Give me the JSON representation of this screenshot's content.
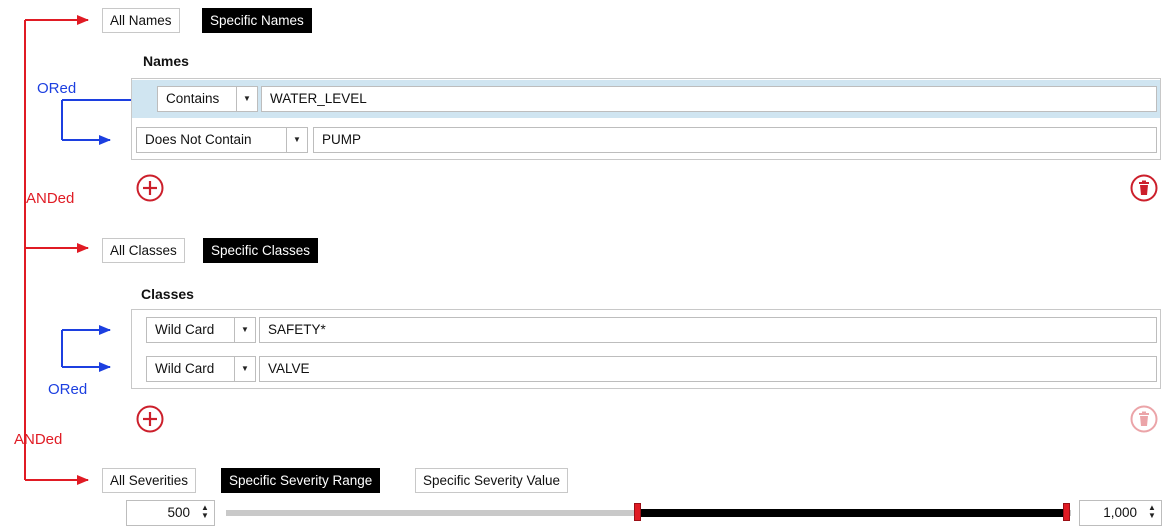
{
  "names_filter": {
    "toggles": [
      "All Names",
      "Specific Names"
    ],
    "selected": "Specific Names",
    "label": "Names",
    "rows": [
      {
        "operator": "Contains",
        "value": "WATER_LEVEL",
        "selected": true
      },
      {
        "operator": "Does Not Contain",
        "value": "PUMP",
        "selected": false
      }
    ]
  },
  "classes_filter": {
    "toggles": [
      "All Classes",
      "Specific Classes"
    ],
    "selected": "Specific Classes",
    "label": "Classes",
    "rows": [
      {
        "operator": "Wild Card",
        "value": "SAFETY*"
      },
      {
        "operator": "Wild Card",
        "value": "VALVE"
      }
    ]
  },
  "severity_filter": {
    "toggles": [
      "All Severities",
      "Specific Severity Range",
      "Specific Severity Value"
    ],
    "selected": "Specific Severity Range",
    "min_value": "500",
    "max_value": "1,000",
    "range_start_fraction": 0.5,
    "range_end_fraction": 1.0
  },
  "annotations": {
    "ored_top": "ORed",
    "ored_bottom": "ORed",
    "anded_top": "ANDed",
    "anded_bottom": "ANDed"
  },
  "icons": {
    "add": "plus-circle-icon",
    "delete": "trash-circle-icon",
    "spinner": "up-down-arrows-icon",
    "dropdown": "caret-down-icon"
  },
  "colors": {
    "anded": "#e01b24",
    "ored": "#1c3fe0",
    "selected_row": "#d0e5f1",
    "toggle_on": "#000000",
    "add_button": "#cc1f2b",
    "delete_disabled": "#eba4a8"
  }
}
